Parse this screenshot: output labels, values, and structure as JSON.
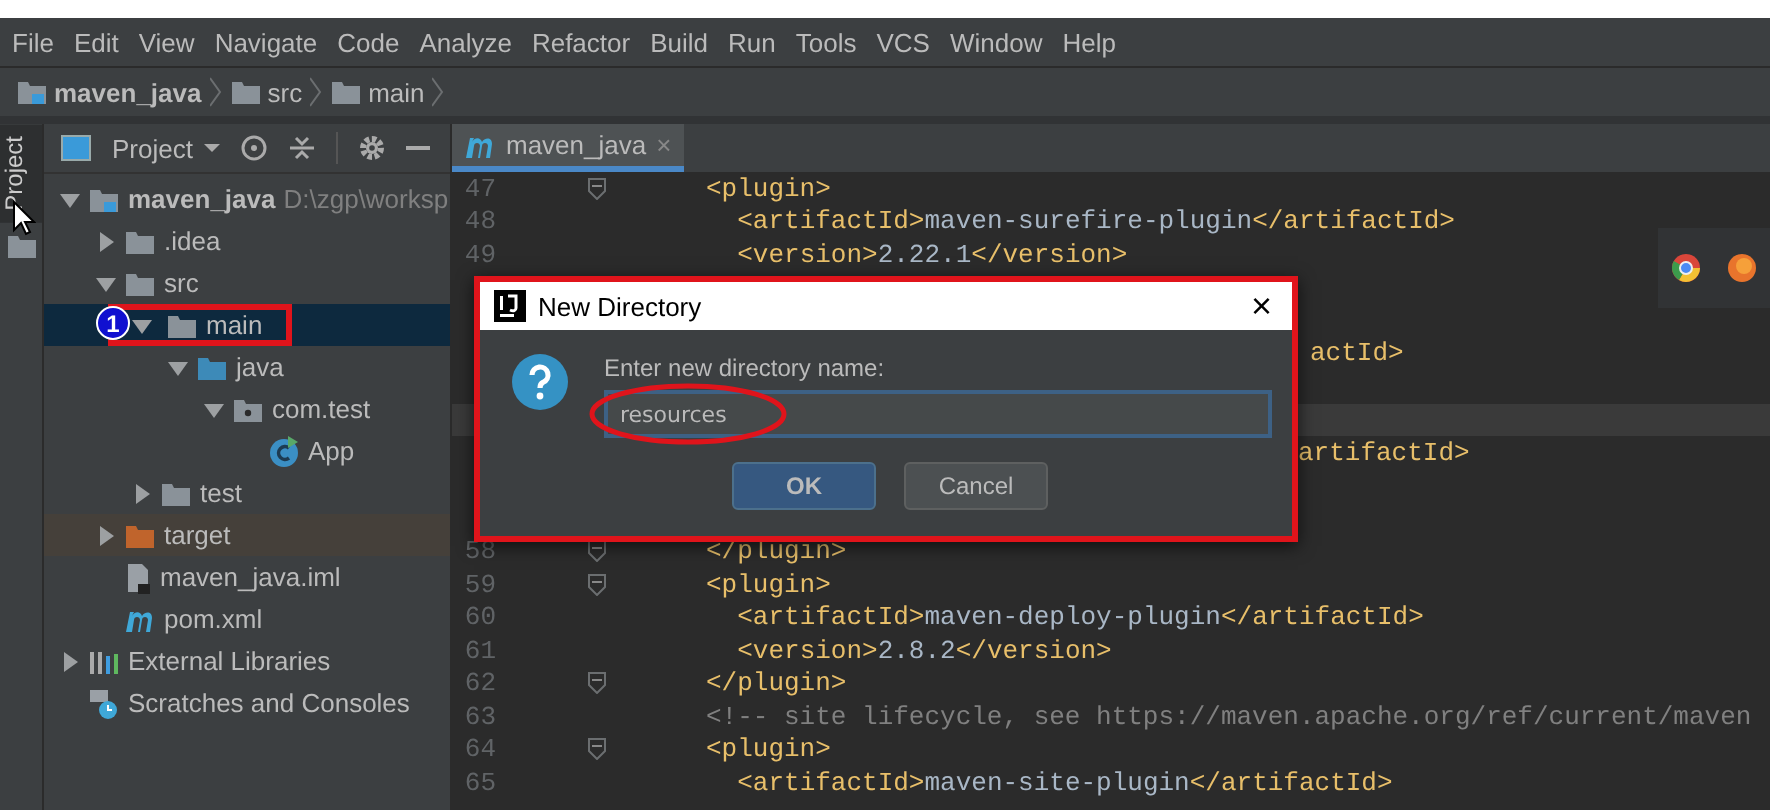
{
  "menu": [
    "File",
    "Edit",
    "View",
    "Navigate",
    "Code",
    "Analyze",
    "Refactor",
    "Build",
    "Run",
    "Tools",
    "VCS",
    "Window",
    "Help"
  ],
  "breadcrumb": [
    {
      "label": "maven_java",
      "kind": "module"
    },
    {
      "label": "src",
      "kind": "folder"
    },
    {
      "label": "main",
      "kind": "folder"
    }
  ],
  "tool_strip": {
    "label": "Project"
  },
  "project_panel": {
    "title": "Project",
    "tree": [
      {
        "label": "maven_java",
        "path": "D:\\zgp\\worksp",
        "kind": "module",
        "expanded": true,
        "selected": false,
        "children": [
          {
            "label": ".idea",
            "kind": "folder",
            "expanded": false,
            "selected": false
          },
          {
            "label": "src",
            "kind": "folder",
            "expanded": true,
            "selected": false,
            "children": [
              {
                "label": "main",
                "kind": "folder",
                "expanded": true,
                "selected": true,
                "badge": "1",
                "children": [
                  {
                    "label": "java",
                    "kind": "source-folder",
                    "expanded": true,
                    "selected": false,
                    "children": [
                      {
                        "label": "com.test",
                        "kind": "package",
                        "expanded": true,
                        "selected": false,
                        "children": [
                          {
                            "label": "App",
                            "kind": "class",
                            "selected": false
                          }
                        ]
                      }
                    ]
                  }
                ]
              },
              {
                "label": "test",
                "kind": "folder",
                "expanded": false,
                "selected": false
              }
            ]
          },
          {
            "label": "target",
            "kind": "excluded-folder",
            "expanded": false,
            "selected": false
          },
          {
            "label": "maven_java.iml",
            "kind": "iml",
            "selected": false
          },
          {
            "label": "pom.xml",
            "kind": "maven",
            "selected": false
          }
        ]
      },
      {
        "label": "External Libraries",
        "kind": "libraries",
        "expanded": false,
        "selected": false
      },
      {
        "label": "Scratches and Consoles",
        "kind": "scratches",
        "selected": false
      }
    ]
  },
  "editor": {
    "tab": {
      "label": "maven_java",
      "close": "×",
      "selected": true
    },
    "lines": [
      {
        "number": "47",
        "kind": "code",
        "text": "<plugin>",
        "fold": true
      },
      {
        "number": "48",
        "kind": "code",
        "text": "  <artifactId>maven-surefire-plugin</artifactId>"
      },
      {
        "number": "49",
        "kind": "code",
        "text": "  <version>2.22.1</version>"
      },
      {
        "kind": "covered"
      },
      {
        "kind": "covered"
      },
      {
        "kind": "covered",
        "text": "actId>"
      },
      {
        "kind": "covered"
      },
      {
        "kind": "covered",
        "current": true
      },
      {
        "kind": "covered",
        "text": "artifactId>"
      },
      {
        "kind": "covered"
      },
      {
        "kind": "covered"
      },
      {
        "number": "58",
        "kind": "code",
        "text": "</plugin>",
        "fold": true
      },
      {
        "number": "59",
        "kind": "code",
        "text": "<plugin>",
        "fold": true
      },
      {
        "number": "60",
        "kind": "code",
        "text": "  <artifactId>maven-deploy-plugin</artifactId>"
      },
      {
        "number": "61",
        "kind": "code",
        "text": "  <version>2.8.2</version>"
      },
      {
        "number": "62",
        "kind": "code",
        "text": "</plugin>",
        "fold": true
      },
      {
        "number": "63",
        "kind": "comment",
        "text": "<!-- site lifecycle, see https://maven.apache.org/ref/current/maven"
      },
      {
        "number": "64",
        "kind": "code",
        "text": "<plugin>",
        "fold": true
      },
      {
        "number": "65",
        "kind": "code",
        "text": "  <artifactId>maven-site-plugin</artifactId>"
      }
    ]
  },
  "dialog": {
    "title": "New Directory",
    "close": "×",
    "prompt": "Enter new directory name:",
    "value": "resources",
    "buttons": [
      {
        "label": "OK",
        "default": true
      },
      {
        "label": "Cancel",
        "default": false
      }
    ]
  }
}
